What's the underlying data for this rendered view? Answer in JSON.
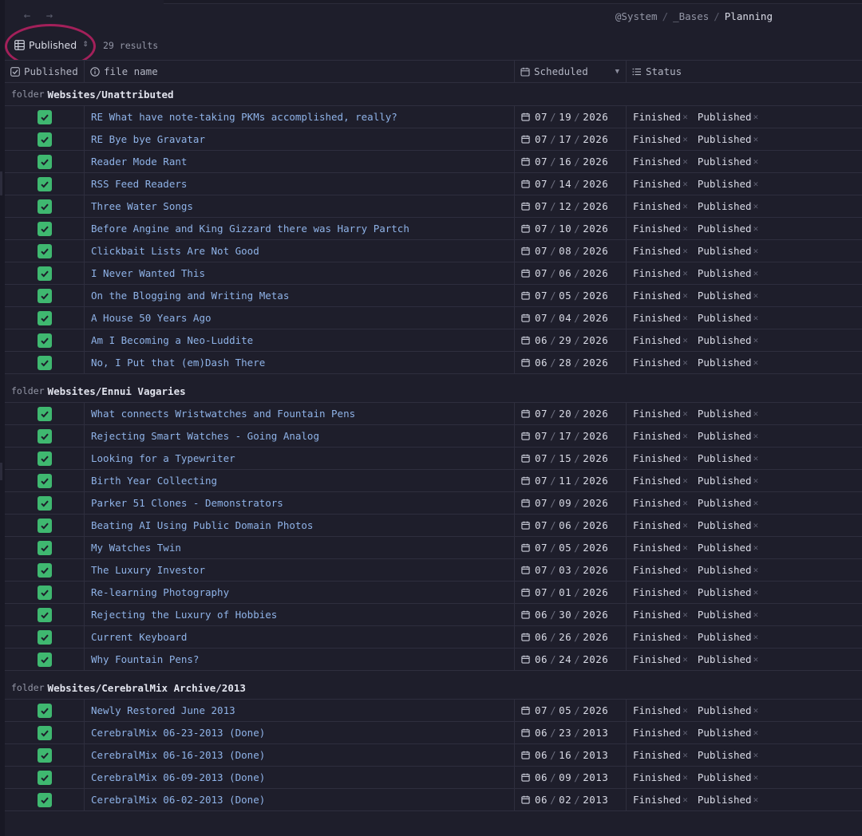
{
  "breadcrumb": [
    "@System",
    "_Bases",
    "Planning"
  ],
  "view": {
    "name": "Published",
    "results": "29 results"
  },
  "columns": {
    "published": "Published",
    "file_name": "file name",
    "scheduled": "Scheduled",
    "status": "Status"
  },
  "colors": {
    "accent_check": "#3fb870",
    "highlight": "#a3205a",
    "link": "#8fb3e8"
  },
  "groups": [
    {
      "key": "folder",
      "value": "Websites/Unattributed",
      "rows": [
        {
          "name": "RE What have note-taking PKMs accomplished, really?",
          "date": [
            "07",
            "19",
            "2026"
          ],
          "status": [
            "Finished",
            "Published"
          ]
        },
        {
          "name": "RE Bye bye Gravatar",
          "date": [
            "07",
            "17",
            "2026"
          ],
          "status": [
            "Finished",
            "Published"
          ]
        },
        {
          "name": "Reader Mode Rant",
          "date": [
            "07",
            "16",
            "2026"
          ],
          "status": [
            "Finished",
            "Published"
          ]
        },
        {
          "name": "RSS Feed Readers",
          "date": [
            "07",
            "14",
            "2026"
          ],
          "status": [
            "Finished",
            "Published"
          ]
        },
        {
          "name": "Three Water Songs",
          "date": [
            "07",
            "12",
            "2026"
          ],
          "status": [
            "Finished",
            "Published"
          ]
        },
        {
          "name": "Before Angine and King Gizzard there was Harry Partch",
          "date": [
            "07",
            "10",
            "2026"
          ],
          "status": [
            "Finished",
            "Published"
          ]
        },
        {
          "name": "Clickbait Lists Are Not Good",
          "date": [
            "07",
            "08",
            "2026"
          ],
          "status": [
            "Finished",
            "Published"
          ]
        },
        {
          "name": "I Never Wanted This",
          "date": [
            "07",
            "06",
            "2026"
          ],
          "status": [
            "Finished",
            "Published"
          ]
        },
        {
          "name": "On the Blogging and Writing Metas",
          "date": [
            "07",
            "05",
            "2026"
          ],
          "status": [
            "Finished",
            "Published"
          ]
        },
        {
          "name": "A House 50 Years Ago",
          "date": [
            "07",
            "04",
            "2026"
          ],
          "status": [
            "Finished",
            "Published"
          ]
        },
        {
          "name": "Am I Becoming a Neo-Luddite",
          "date": [
            "06",
            "29",
            "2026"
          ],
          "status": [
            "Finished",
            "Published"
          ]
        },
        {
          "name": "No, I Put that (em)Dash There",
          "date": [
            "06",
            "28",
            "2026"
          ],
          "status": [
            "Finished",
            "Published"
          ]
        }
      ]
    },
    {
      "key": "folder",
      "value": "Websites/Ennui Vagaries",
      "rows": [
        {
          "name": "What connects Wristwatches and Fountain Pens",
          "date": [
            "07",
            "20",
            "2026"
          ],
          "status": [
            "Finished",
            "Published"
          ]
        },
        {
          "name": "Rejecting Smart Watches - Going Analog",
          "date": [
            "07",
            "17",
            "2026"
          ],
          "status": [
            "Finished",
            "Published"
          ]
        },
        {
          "name": "Looking for a Typewriter",
          "date": [
            "07",
            "15",
            "2026"
          ],
          "status": [
            "Finished",
            "Published"
          ]
        },
        {
          "name": "Birth Year Collecting",
          "date": [
            "07",
            "11",
            "2026"
          ],
          "status": [
            "Finished",
            "Published"
          ]
        },
        {
          "name": "Parker 51 Clones - Demonstrators",
          "date": [
            "07",
            "09",
            "2026"
          ],
          "status": [
            "Finished",
            "Published"
          ]
        },
        {
          "name": "Beating AI Using Public Domain Photos",
          "date": [
            "07",
            "06",
            "2026"
          ],
          "status": [
            "Finished",
            "Published"
          ]
        },
        {
          "name": "My Watches Twin",
          "date": [
            "07",
            "05",
            "2026"
          ],
          "status": [
            "Finished",
            "Published"
          ]
        },
        {
          "name": "The Luxury Investor",
          "date": [
            "07",
            "03",
            "2026"
          ],
          "status": [
            "Finished",
            "Published"
          ]
        },
        {
          "name": "Re-learning Photography",
          "date": [
            "07",
            "01",
            "2026"
          ],
          "status": [
            "Finished",
            "Published"
          ]
        },
        {
          "name": "Rejecting the Luxury of Hobbies",
          "date": [
            "06",
            "30",
            "2026"
          ],
          "status": [
            "Finished",
            "Published"
          ]
        },
        {
          "name": "Current Keyboard",
          "date": [
            "06",
            "26",
            "2026"
          ],
          "status": [
            "Finished",
            "Published"
          ]
        },
        {
          "name": "Why Fountain Pens?",
          "date": [
            "06",
            "24",
            "2026"
          ],
          "status": [
            "Finished",
            "Published"
          ]
        }
      ]
    },
    {
      "key": "folder",
      "value": "Websites/CerebralMix Archive/2013",
      "rows": [
        {
          "name": "Newly Restored June 2013",
          "date": [
            "07",
            "05",
            "2026"
          ],
          "status": [
            "Finished",
            "Published"
          ]
        },
        {
          "name": "CerebralMix 06-23-2013 (Done)",
          "date": [
            "06",
            "23",
            "2013"
          ],
          "status": [
            "Finished",
            "Published"
          ]
        },
        {
          "name": "CerebralMix 06-16-2013 (Done)",
          "date": [
            "06",
            "16",
            "2013"
          ],
          "status": [
            "Finished",
            "Published"
          ]
        },
        {
          "name": "CerebralMix 06-09-2013 (Done)",
          "date": [
            "06",
            "09",
            "2013"
          ],
          "status": [
            "Finished",
            "Published"
          ]
        },
        {
          "name": "CerebralMix 06-02-2013 (Done)",
          "date": [
            "06",
            "02",
            "2013"
          ],
          "status": [
            "Finished",
            "Published"
          ]
        }
      ]
    }
  ]
}
